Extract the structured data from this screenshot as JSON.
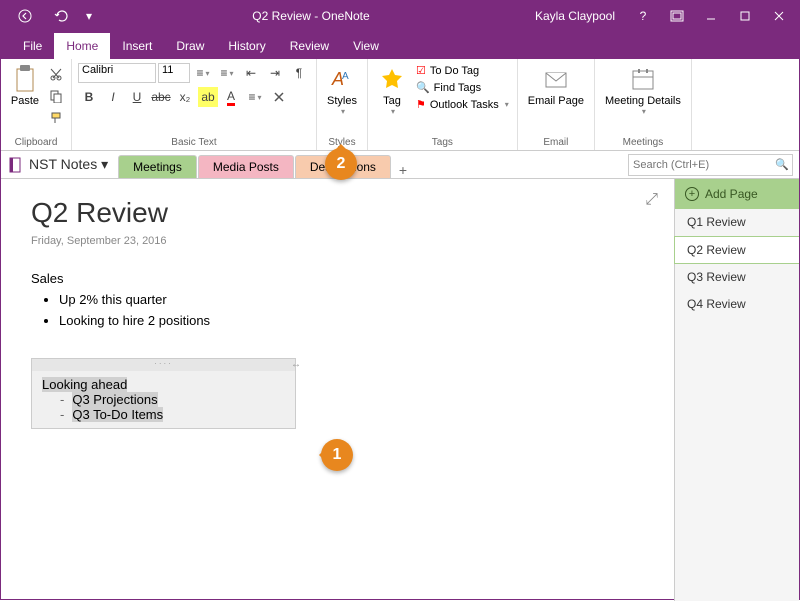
{
  "titlebar": {
    "app_title": "Q2 Review - OneNote",
    "user": "Kayla Claypool"
  },
  "menu": {
    "file": "File",
    "home": "Home",
    "insert": "Insert",
    "draw": "Draw",
    "history": "History",
    "review": "Review",
    "view": "View"
  },
  "ribbon": {
    "clipboard": {
      "paste": "Paste",
      "label": "Clipboard"
    },
    "basic_text": {
      "font": "Calibri",
      "size": "11",
      "label": "Basic Text"
    },
    "styles": {
      "btn": "Styles",
      "label": "Styles"
    },
    "tags": {
      "tag_btn": "Tag",
      "todo": "To Do Tag",
      "find": "Find Tags",
      "outlook": "Outlook Tasks",
      "label": "Tags"
    },
    "email": {
      "btn": "Email Page",
      "label": "Email"
    },
    "meetings": {
      "btn": "Meeting Details",
      "label": "Meetings"
    }
  },
  "notebook": {
    "name": "NST Notes",
    "sections": [
      "Meetings",
      "Media Posts",
      "Destinations"
    ],
    "search_placeholder": "Search (Ctrl+E)"
  },
  "page": {
    "title": "Q2 Review",
    "date": "Friday, September 23, 2016",
    "sales_heading": "Sales",
    "bullets": [
      "Up 2% this quarter",
      "Looking to hire 2 positions"
    ],
    "container": {
      "heading": "Looking ahead",
      "items": [
        "Q3 Projections",
        "Q3 To-Do Items"
      ]
    }
  },
  "pages_panel": {
    "add": "Add Page",
    "items": [
      "Q1 Review",
      "Q2 Review",
      "Q3 Review",
      "Q4 Review"
    ],
    "active_index": 1
  },
  "callouts": {
    "one": "1",
    "two": "2"
  }
}
